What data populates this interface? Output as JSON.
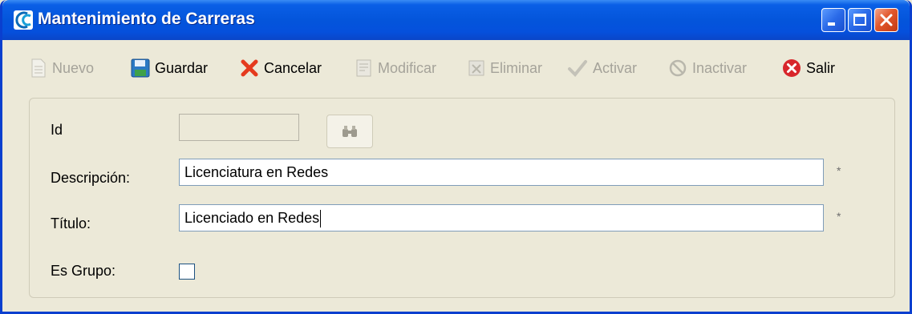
{
  "window": {
    "title": "Mantenimiento de Carreras"
  },
  "toolbar": {
    "nuevo": "Nuevo",
    "guardar": "Guardar",
    "cancelar": "Cancelar",
    "modificar": "Modificar",
    "eliminar": "Eliminar",
    "activar": "Activar",
    "inactivar": "Inactivar",
    "salir": "Salir"
  },
  "form": {
    "id_label": "Id",
    "id_value": "",
    "descripcion_label": "Descripción:",
    "descripcion_value": "Licenciatura en Redes",
    "titulo_label": "Título:",
    "titulo_value": "Licenciado en Redes",
    "es_grupo_label": "Es Grupo:",
    "es_grupo_checked": false,
    "required_mark": "*"
  },
  "icons": {
    "app": "app-logo-icon",
    "nuevo": "document-icon",
    "guardar": "floppy-disk-icon",
    "cancelar": "red-x-icon",
    "modificar": "edit-document-icon",
    "eliminar": "delete-icon",
    "activar": "checkmark-icon",
    "inactivar": "prohibited-icon",
    "salir": "exit-icon",
    "buscar": "binoculars-icon"
  },
  "colors": {
    "titlebar": "#0455db",
    "background": "#ece9d8",
    "disabled_text": "#a5a39a",
    "close_button": "#e2572c"
  }
}
